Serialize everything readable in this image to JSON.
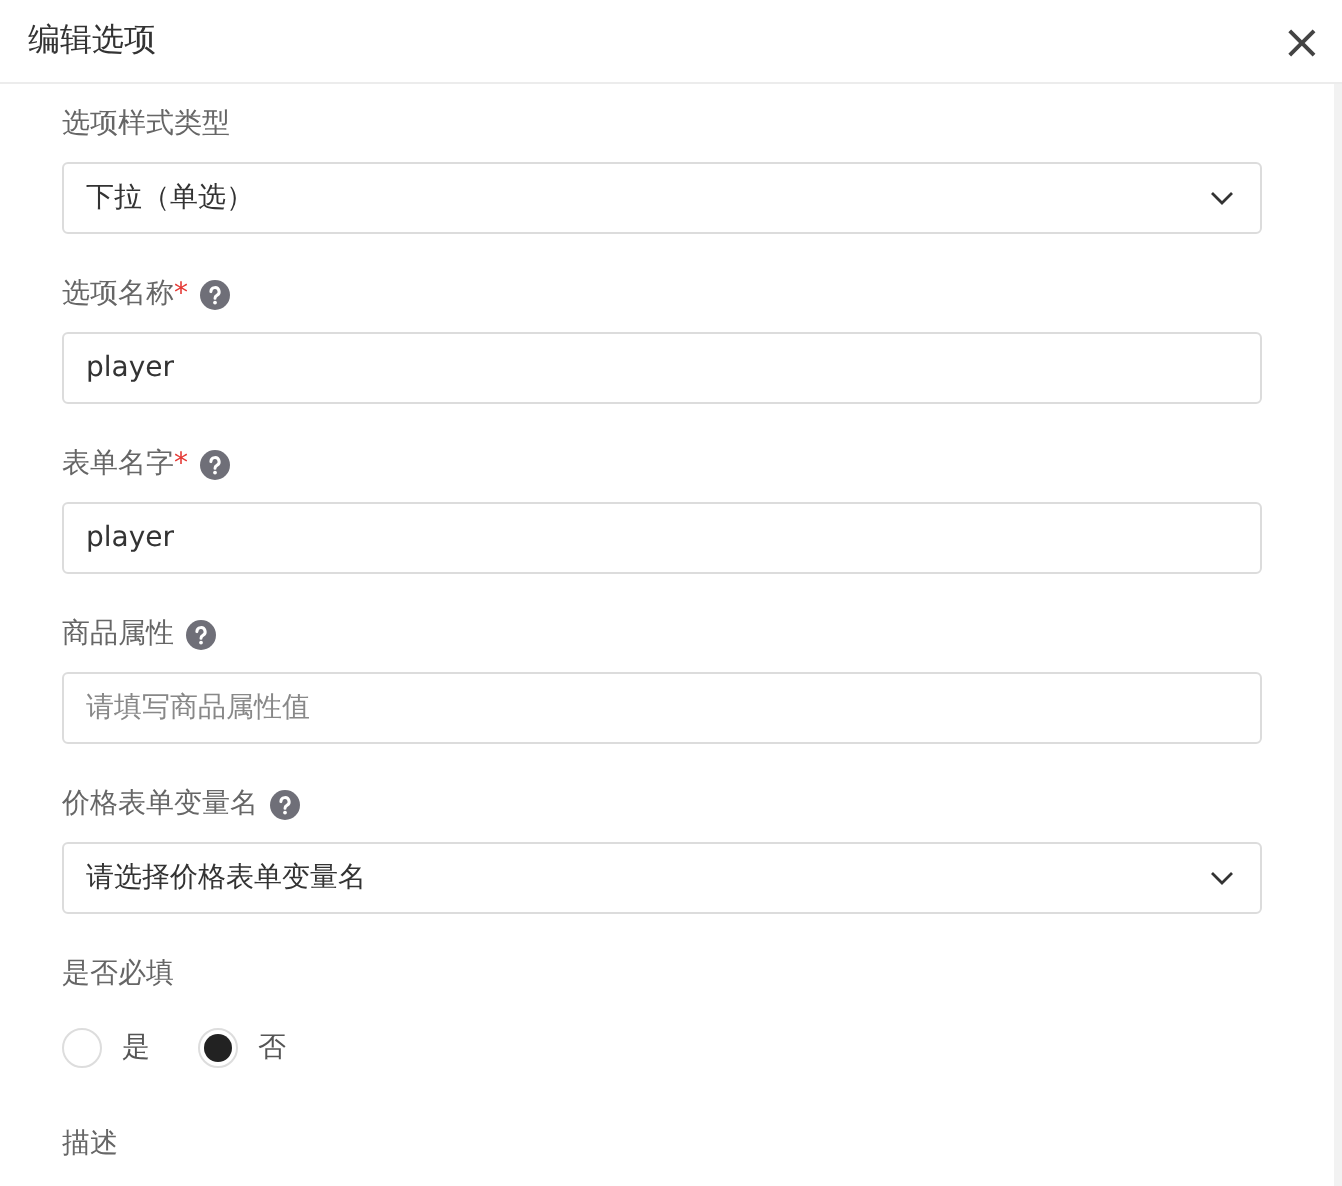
{
  "dialog": {
    "title": "编辑选项",
    "close": "×"
  },
  "fields": [
    {
      "kind": "select",
      "label": "选项样式类型",
      "help": false,
      "value": "下拉（单选）"
    },
    {
      "kind": "text",
      "label": "选项名称",
      "required_mark": "*",
      "help": true,
      "value": "player"
    },
    {
      "kind": "text",
      "label": "表单名字",
      "required_mark": "*",
      "help": true,
      "value": "player"
    },
    {
      "kind": "text",
      "label": "商品属性",
      "help": true,
      "placeholder": "请填写商品属性值"
    },
    {
      "kind": "select",
      "label": "价格表单变量名",
      "help": true,
      "value": "请选择价格表单变量名"
    },
    {
      "kind": "radio",
      "label": "是否必填",
      "help": false,
      "options": [
        {
          "label": "是",
          "selected": false
        },
        {
          "label": "否",
          "selected": true
        }
      ]
    },
    {
      "kind": "heading",
      "label": "描述",
      "help": false
    }
  ]
}
